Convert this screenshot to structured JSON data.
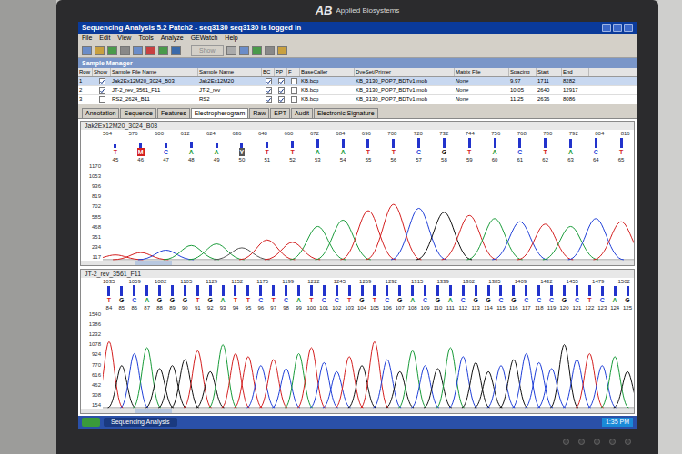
{
  "monitor": {
    "logo": "AB",
    "brand": "Applied Biosystems"
  },
  "window": {
    "title": "Sequencing Analysis 5.2 Patch2 - seq3130 seq3130 is logged in"
  },
  "menu": [
    "File",
    "Edit",
    "View",
    "Tools",
    "Analyze",
    "GEWatch",
    "Help"
  ],
  "toolbar": {
    "button": "Show",
    "disabled": true
  },
  "sample_manager": {
    "title": "Sample Manager",
    "columns": [
      "Row",
      "Show",
      "Sample File Name",
      "Sample Name",
      "BC",
      "PP",
      "F",
      "BaseCaller",
      "DyeSet/Primer",
      "Matrix File",
      "Spacing",
      "Start",
      "End"
    ],
    "rows": [
      {
        "row": "1",
        "show": true,
        "file": "Jak2Ex12M20_3024_B03",
        "name": "Jak2Ex12M20",
        "bc": true,
        "pp": true,
        "f": false,
        "basecaller": "KB.bcp",
        "dyeset": "KB_3130_POP7_BDTv1.mob",
        "matrix": "None",
        "spacing": "9.97",
        "start": "1711",
        "end": "8282",
        "selected": true
      },
      {
        "row": "2",
        "show": true,
        "file": "JT-2_rev_3561_F11",
        "name": "JT-2_rev",
        "bc": true,
        "pp": true,
        "f": false,
        "basecaller": "KB.bcp",
        "dyeset": "KB_3130_POP7_BDTv1.mob",
        "matrix": "None",
        "spacing": "10.05",
        "start": "2640",
        "end": "12917",
        "selected": false
      },
      {
        "row": "3",
        "show": false,
        "file": "RS2_2624_B11",
        "name": "RS2",
        "bc": true,
        "pp": true,
        "f": false,
        "basecaller": "KB.bcp",
        "dyeset": "KB_3130_POP7_BDTv1.mob",
        "matrix": "None",
        "spacing": "11.25",
        "start": "2636",
        "end": "8086",
        "selected": false
      }
    ]
  },
  "tabs": [
    {
      "label": "Annotation",
      "selected": false
    },
    {
      "label": "Sequence",
      "selected": false
    },
    {
      "label": "Features",
      "selected": false
    },
    {
      "label": "Electropherogram",
      "selected": true
    },
    {
      "label": "Raw",
      "selected": false
    },
    {
      "label": "EPT",
      "selected": false
    },
    {
      "label": "Audit",
      "selected": false
    },
    {
      "label": "Electronic Signature",
      "selected": false
    }
  ],
  "traces": [
    {
      "name": "Jak2Ex12M20_3024_B03",
      "max": 1170,
      "y_ticks": [
        "1170",
        "1053",
        "936",
        "819",
        "702",
        "585",
        "468",
        "351",
        "234",
        "117"
      ],
      "ruler": [
        "564",
        "576",
        "600",
        "612",
        "624",
        "636",
        "648",
        "660",
        "672",
        "684",
        "696",
        "708",
        "720",
        "732",
        "744",
        "756",
        "768",
        "780",
        "792",
        "804",
        "816"
      ],
      "calls": [
        {
          "base": "T",
          "index": "45",
          "color": "#d42020",
          "quality": 0.3,
          "height": 60,
          "mixed": false
        },
        {
          "base": "M",
          "index": "46",
          "color": "#d42020",
          "quality": 0.5,
          "height": 90,
          "mixed": true
        },
        {
          "base": "C",
          "index": "47",
          "color": "#1f3fd8",
          "quality": 0.4,
          "height": 120,
          "mixed": false
        },
        {
          "base": "A",
          "index": "48",
          "color": "#1a9c3a",
          "quality": 0.6,
          "height": 180,
          "mixed": false
        },
        {
          "base": "A",
          "index": "49",
          "color": "#1a9c3a",
          "quality": 0.5,
          "height": 200,
          "mixed": false
        },
        {
          "base": "Y",
          "index": "50",
          "color": "#555555",
          "quality": 0.4,
          "height": 150,
          "mixed": true
        },
        {
          "base": "T",
          "index": "51",
          "color": "#d42020",
          "quality": 0.6,
          "height": 250,
          "mixed": false
        },
        {
          "base": "T",
          "index": "52",
          "color": "#d42020",
          "quality": 0.7,
          "height": 220,
          "mixed": false
        },
        {
          "base": "A",
          "index": "53",
          "color": "#1a9c3a",
          "quality": 0.8,
          "height": 420,
          "mixed": false
        },
        {
          "base": "A",
          "index": "54",
          "color": "#1a9c3a",
          "quality": 0.8,
          "height": 500,
          "mixed": false
        },
        {
          "base": "T",
          "index": "55",
          "color": "#d42020",
          "quality": 0.85,
          "height": 620,
          "mixed": false
        },
        {
          "base": "T",
          "index": "56",
          "color": "#d42020",
          "quality": 0.85,
          "height": 700,
          "mixed": false
        },
        {
          "base": "C",
          "index": "57",
          "color": "#1f3fd8",
          "quality": 0.9,
          "height": 650,
          "mixed": false
        },
        {
          "base": "G",
          "index": "58",
          "color": "#111111",
          "quality": 0.9,
          "height": 600,
          "mixed": false
        },
        {
          "base": "T",
          "index": "59",
          "color": "#d42020",
          "quality": 0.95,
          "height": 560,
          "mixed": false
        },
        {
          "base": "A",
          "index": "60",
          "color": "#1a9c3a",
          "quality": 0.9,
          "height": 520,
          "mixed": false
        },
        {
          "base": "C",
          "index": "61",
          "color": "#1f3fd8",
          "quality": 0.9,
          "height": 480,
          "mixed": false
        },
        {
          "base": "T",
          "index": "62",
          "color": "#d42020",
          "quality": 0.9,
          "height": 450,
          "mixed": false
        },
        {
          "base": "A",
          "index": "63",
          "color": "#1a9c3a",
          "quality": 0.85,
          "height": 420,
          "mixed": false
        },
        {
          "base": "C",
          "index": "64",
          "color": "#1f3fd8",
          "quality": 0.9,
          "height": 520,
          "mixed": false
        },
        {
          "base": "T",
          "index": "65",
          "color": "#d42020",
          "quality": 0.9,
          "height": 480,
          "mixed": false
        }
      ]
    },
    {
      "name": "JT-2_rev_3561_F11",
      "max": 1540,
      "y_ticks": [
        "1540",
        "1386",
        "1232",
        "1078",
        "924",
        "770",
        "616",
        "462",
        "308",
        "154"
      ],
      "ruler": [
        "1035",
        "1059",
        "1082",
        "1105",
        "1129",
        "1152",
        "1175",
        "1199",
        "1222",
        "1245",
        "1269",
        "1292",
        "1315",
        "1339",
        "1362",
        "1385",
        "1409",
        "1432",
        "1455",
        "1479",
        "1502"
      ],
      "calls": [
        {
          "base": "T",
          "index": "84",
          "color": "#d42020",
          "quality": 0.9,
          "height": 1100,
          "mixed": false
        },
        {
          "base": "G",
          "index": "85",
          "color": "#111111",
          "quality": 0.9,
          "height": 700,
          "mixed": false
        },
        {
          "base": "C",
          "index": "86",
          "color": "#1f3fd8",
          "quality": 1,
          "height": 900,
          "mixed": false
        },
        {
          "base": "A",
          "index": "87",
          "color": "#1a9c3a",
          "quality": 1,
          "height": 1000,
          "mixed": false
        },
        {
          "base": "G",
          "index": "88",
          "color": "#111111",
          "quality": 1,
          "height": 650,
          "mixed": false
        },
        {
          "base": "G",
          "index": "89",
          "color": "#111111",
          "quality": 1,
          "height": 700,
          "mixed": false
        },
        {
          "base": "G",
          "index": "90",
          "color": "#111111",
          "quality": 1,
          "height": 800,
          "mixed": false
        },
        {
          "base": "T",
          "index": "91",
          "color": "#d42020",
          "quality": 1,
          "height": 950,
          "mixed": false
        },
        {
          "base": "G",
          "index": "92",
          "color": "#111111",
          "quality": 1,
          "height": 600,
          "mixed": false
        },
        {
          "base": "A",
          "index": "93",
          "color": "#1a9c3a",
          "quality": 1,
          "height": 1050,
          "mixed": false
        },
        {
          "base": "T",
          "index": "94",
          "color": "#d42020",
          "quality": 1,
          "height": 900,
          "mixed": false
        },
        {
          "base": "T",
          "index": "95",
          "color": "#d42020",
          "quality": 1,
          "height": 850,
          "mixed": false
        },
        {
          "base": "C",
          "index": "96",
          "color": "#1f3fd8",
          "quality": 1,
          "height": 700,
          "mixed": false
        },
        {
          "base": "T",
          "index": "97",
          "color": "#d42020",
          "quality": 1,
          "height": 800,
          "mixed": false
        },
        {
          "base": "C",
          "index": "98",
          "color": "#1f3fd8",
          "quality": 1,
          "height": 650,
          "mixed": false
        },
        {
          "base": "A",
          "index": "99",
          "color": "#1a9c3a",
          "quality": 1,
          "height": 900,
          "mixed": false
        },
        {
          "base": "T",
          "index": "100",
          "color": "#d42020",
          "quality": 1,
          "height": 1000,
          "mixed": false
        },
        {
          "base": "C",
          "index": "101",
          "color": "#1f3fd8",
          "quality": 1,
          "height": 750,
          "mixed": false
        },
        {
          "base": "C",
          "index": "102",
          "color": "#1f3fd8",
          "quality": 1,
          "height": 600,
          "mixed": false
        },
        {
          "base": "T",
          "index": "103",
          "color": "#d42020",
          "quality": 1,
          "height": 850,
          "mixed": false
        },
        {
          "base": "G",
          "index": "104",
          "color": "#111111",
          "quality": 1,
          "height": 700,
          "mixed": false
        },
        {
          "base": "T",
          "index": "105",
          "color": "#d42020",
          "quality": 1,
          "height": 1100,
          "mixed": false
        },
        {
          "base": "C",
          "index": "106",
          "color": "#1f3fd8",
          "quality": 1,
          "height": 800,
          "mixed": false
        },
        {
          "base": "G",
          "index": "107",
          "color": "#111111",
          "quality": 1,
          "height": 600,
          "mixed": false
        },
        {
          "base": "A",
          "index": "108",
          "color": "#1a9c3a",
          "quality": 1,
          "height": 950,
          "mixed": false
        },
        {
          "base": "C",
          "index": "109",
          "color": "#1f3fd8",
          "quality": 1,
          "height": 700,
          "mixed": false
        },
        {
          "base": "G",
          "index": "110",
          "color": "#111111",
          "quality": 1,
          "height": 650,
          "mixed": false
        },
        {
          "base": "A",
          "index": "111",
          "color": "#1a9c3a",
          "quality": 1,
          "height": 1000,
          "mixed": false
        },
        {
          "base": "C",
          "index": "112",
          "color": "#1f3fd8",
          "quality": 1,
          "height": 850,
          "mixed": false
        },
        {
          "base": "G",
          "index": "113",
          "color": "#111111",
          "quality": 1,
          "height": 750,
          "mixed": false
        },
        {
          "base": "G",
          "index": "114",
          "color": "#111111",
          "quality": 1,
          "height": 600,
          "mixed": false
        },
        {
          "base": "C",
          "index": "115",
          "color": "#1f3fd8",
          "quality": 1,
          "height": 700,
          "mixed": false
        },
        {
          "base": "G",
          "index": "116",
          "color": "#111111",
          "quality": 1,
          "height": 800,
          "mixed": false
        },
        {
          "base": "C",
          "index": "117",
          "color": "#1f3fd8",
          "quality": 1,
          "height": 900,
          "mixed": false
        },
        {
          "base": "C",
          "index": "118",
          "color": "#1f3fd8",
          "quality": 1,
          "height": 750,
          "mixed": false
        },
        {
          "base": "C",
          "index": "119",
          "color": "#1f3fd8",
          "quality": 1,
          "height": 650,
          "mixed": false
        },
        {
          "base": "G",
          "index": "120",
          "color": "#111111",
          "quality": 1,
          "height": 1050,
          "mixed": false
        },
        {
          "base": "C",
          "index": "121",
          "color": "#1f3fd8",
          "quality": 1,
          "height": 800,
          "mixed": false
        },
        {
          "base": "T",
          "index": "122",
          "color": "#d42020",
          "quality": 1,
          "height": 900,
          "mixed": false
        },
        {
          "base": "C",
          "index": "123",
          "color": "#1f3fd8",
          "quality": 0.9,
          "height": 700,
          "mixed": false
        },
        {
          "base": "A",
          "index": "124",
          "color": "#1a9c3a",
          "quality": 0.9,
          "height": 850,
          "mixed": false
        },
        {
          "base": "G",
          "index": "125",
          "color": "#111111",
          "quality": 0.9,
          "height": 600,
          "mixed": false
        }
      ]
    }
  ],
  "taskbar": {
    "apps": [
      {
        "label": "Sequencing Analysis",
        "selected": true
      }
    ],
    "clock": "1:35 PM"
  }
}
